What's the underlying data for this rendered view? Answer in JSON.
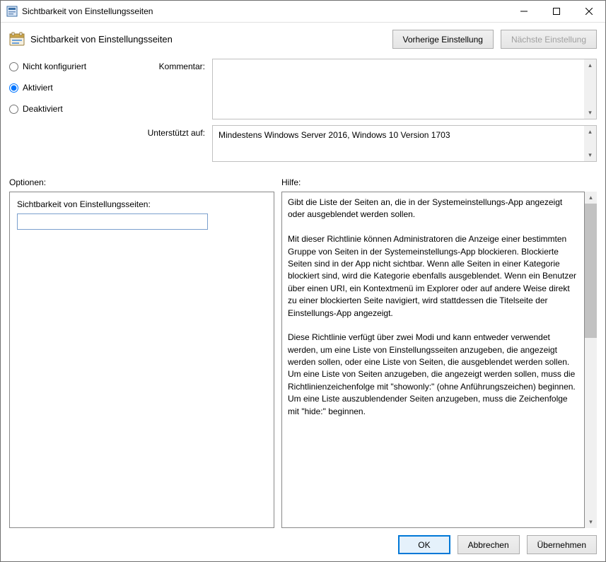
{
  "window": {
    "title": "Sichtbarkeit von Einstellungsseiten"
  },
  "header": {
    "title": "Sichtbarkeit von Einstellungsseiten"
  },
  "nav": {
    "prev": "Vorherige Einstellung",
    "next": "Nächste Einstellung"
  },
  "state": {
    "not_configured": "Nicht konfiguriert",
    "enabled": "Aktiviert",
    "disabled": "Deaktiviert",
    "selected": "enabled"
  },
  "labels": {
    "comment": "Kommentar:",
    "supported": "Unterstützt auf:",
    "options": "Optionen:",
    "help": "Hilfe:",
    "option_field": "Sichtbarkeit von Einstellungsseiten:"
  },
  "comment": "",
  "supported_text": "Mindestens Windows Server 2016, Windows 10 Version 1703",
  "option_value": "",
  "help_text": {
    "p1": "Gibt die Liste der Seiten an, die in der Systemeinstellungs-App angezeigt oder ausgeblendet werden sollen.",
    "p2": "Mit dieser Richtlinie können Administratoren die Anzeige einer bestimmten Gruppe von Seiten in der Systemeinstellungs-App blockieren. Blockierte Seiten sind in der App nicht sichtbar. Wenn alle Seiten in einer Kategorie blockiert sind, wird die Kategorie ebenfalls ausgeblendet. Wenn ein Benutzer über einen URI, ein Kontextmenü im Explorer oder auf andere Weise direkt zu einer blockierten Seite navigiert, wird stattdessen die Titelseite der Einstellungs-App angezeigt.",
    "p3": "Diese Richtlinie verfügt über zwei Modi und kann entweder verwendet werden, um eine Liste von Einstellungsseiten anzugeben, die angezeigt werden sollen, oder eine Liste von Seiten, die ausgeblendet werden sollen. Um eine Liste von Seiten anzugeben, die angezeigt werden sollen, muss die Richtlinienzeichenfolge mit \"showonly:\" (ohne Anführungszeichen) beginnen. Um eine Liste auszublendender Seiten anzugeben, muss die Zeichenfolge mit \"hide:\" beginnen."
  },
  "buttons": {
    "ok": "OK",
    "cancel": "Abbrechen",
    "apply": "Übernehmen"
  }
}
